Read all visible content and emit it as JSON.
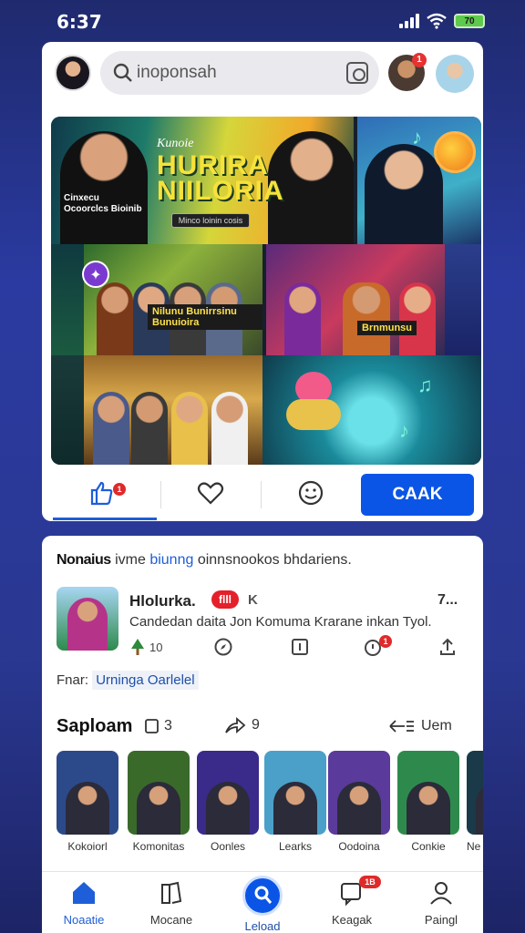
{
  "status_bar": {
    "time": "6:37",
    "battery": "70"
  },
  "search": {
    "placeholder": "inoponsah"
  },
  "header": {
    "notif_count": "1"
  },
  "hero": {
    "small_text": "Kunoie",
    "title_line1": "HURIRA",
    "title_line2": "NIILORIA",
    "caption": "Cinxecu Ocoorclcs Bioinib",
    "button": "Minco loinin cosis",
    "sticker_mid1": "Nilunu Bunirrsinu Bunuioira",
    "sticker_mid2": "Brnmunsu"
  },
  "actions": {
    "like_badge": "1",
    "primary_button": "CAAK"
  },
  "post_header": {
    "label": "Nonaius",
    "text": "ivme",
    "link": "biunng",
    "rest": "oinnsnookos bhdariens."
  },
  "post": {
    "title": "Hlolurka.",
    "pill": "flll",
    "k": "K",
    "more": "7...",
    "text": "Candedan daita Jon Komuma Krarane inkan Tyol.",
    "stats": [
      {
        "icon": "tree-icon",
        "value": "10"
      },
      {
        "icon": "compass-icon",
        "value": ""
      },
      {
        "icon": "save-icon",
        "value": ""
      },
      {
        "icon": "alert-icon",
        "value": ""
      },
      {
        "icon": "share-up-icon",
        "value": ""
      }
    ]
  },
  "from": {
    "label": "Fnar:",
    "link": "Urninga Oarlelel"
  },
  "section": {
    "title": "Saploam",
    "count": "3",
    "share_count": "9",
    "view_label": "Uem"
  },
  "thumbnails": [
    {
      "label": "Kokoiorl",
      "color": "#2c4a8a"
    },
    {
      "label": "Komonitas",
      "color": "#3a6a2a"
    },
    {
      "label": "Oonles",
      "color": "#3a2a8a"
    },
    {
      "label": "Learks",
      "color": "#4aa0c8"
    },
    {
      "label": "Oodoina",
      "color": "#5a3a9a"
    },
    {
      "label": "Conkie",
      "color": "#2e8a4c"
    },
    {
      "label": "Ne",
      "color": "#1a3a4a"
    }
  ],
  "nav": {
    "items": [
      {
        "label": "Noaatie"
      },
      {
        "label": "Mocane"
      },
      {
        "label": "Leload"
      },
      {
        "label": "Keagak"
      },
      {
        "label": "Paingl"
      }
    ],
    "badge": "1B"
  }
}
